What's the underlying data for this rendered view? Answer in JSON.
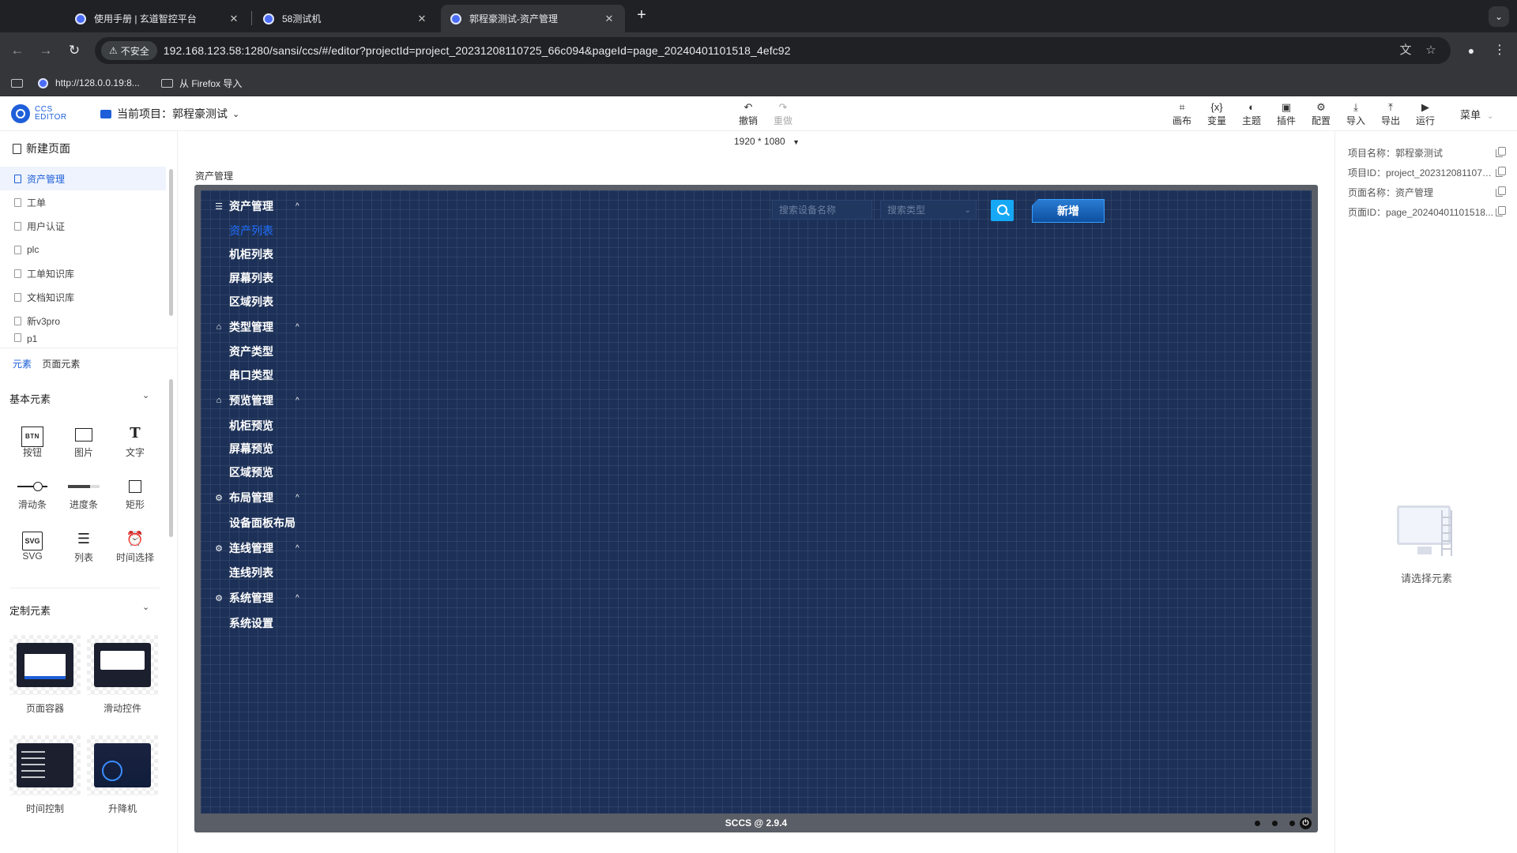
{
  "browser": {
    "tabs": [
      {
        "title": "使用手册 | 玄道智控平台",
        "active": false
      },
      {
        "title": "58测试机",
        "active": false
      },
      {
        "title": "郭程豪测试-资产管理",
        "active": true
      }
    ],
    "security_label": "不安全",
    "url": "192.168.123.58:1280/sansi/ccs/#/editor?projectId=project_20231208110725_66c094&pageId=page_20240401101518_4efc92",
    "bookmarks": [
      "http://128.0.0.19:8...",
      "从 Firefox 导入"
    ]
  },
  "header": {
    "logo_line1": "CCS",
    "logo_line2": "EDITOR",
    "project_label": "当前项目：",
    "project_name": "郭程豪测试",
    "tools": [
      {
        "label": "撤销",
        "icon": "undo-icon",
        "enabled": true
      },
      {
        "label": "重做",
        "icon": "redo-icon",
        "enabled": false
      },
      {
        "label": "画布",
        "icon": "canvas-icon",
        "enabled": true
      },
      {
        "label": "变量",
        "icon": "variable-icon",
        "enabled": true
      },
      {
        "label": "主题",
        "icon": "theme-icon",
        "enabled": true
      },
      {
        "label": "插件",
        "icon": "plugin-icon",
        "enabled": true
      },
      {
        "label": "配置",
        "icon": "config-icon",
        "enabled": true
      },
      {
        "label": "导入",
        "icon": "import-icon",
        "enabled": true
      },
      {
        "label": "导出",
        "icon": "export-icon",
        "enabled": true
      },
      {
        "label": "运行",
        "icon": "run-icon",
        "enabled": true
      }
    ],
    "menu_label": "菜单"
  },
  "left": {
    "new_page_label": "新建页面",
    "pages": [
      "资产管理",
      "工单",
      "用户认证",
      "plc",
      "工单知识库",
      "文档知识库",
      "新v3pro",
      "p1"
    ],
    "active_page": "资产管理",
    "element_tabs": [
      "元素",
      "页面元素"
    ],
    "basic_section": "基本元素",
    "basic_elements": [
      "按钮",
      "图片",
      "文字",
      "滑动条",
      "进度条",
      "矩形",
      "SVG",
      "列表",
      "时间选择"
    ],
    "btn_glyph": "BTN",
    "svg_glyph": "SVG",
    "custom_section": "定制元素",
    "custom_elements": [
      "页面容器",
      "滑动控件",
      "时间控制",
      "升降机"
    ]
  },
  "canvas": {
    "size": "1920 * 1080",
    "page_label": "资产管理",
    "footer": "SCCS @ 2.9.4",
    "preview": {
      "groups": [
        {
          "label": "资产管理",
          "icon": "menu-icon",
          "items": [
            "资产列表",
            "机柜列表",
            "屏幕列表",
            "区域列表"
          ]
        },
        {
          "label": "类型管理",
          "icon": "monitor-icon",
          "items": [
            "资产类型",
            "串口类型"
          ]
        },
        {
          "label": "预览管理",
          "icon": "monitor-icon",
          "items": [
            "机柜预览",
            "屏幕预览",
            "区域预览"
          ]
        },
        {
          "label": "布局管理",
          "icon": "gear-icon",
          "items": [
            "设备面板布局"
          ]
        },
        {
          "label": "连线管理",
          "icon": "gear-icon",
          "items": [
            "连线列表"
          ]
        },
        {
          "label": "系统管理",
          "icon": "gear-icon",
          "items": [
            "系统设置"
          ]
        }
      ],
      "active_item": "资产列表",
      "search_placeholder": "搜索设备名称",
      "type_placeholder": "搜索类型",
      "add_label": "新增"
    }
  },
  "right": {
    "project_name_label": "项目名称：",
    "project_name": "郭程豪测试",
    "project_id_label": "项目ID：",
    "project_id": "project_2023120811072...",
    "page_name_label": "页面名称：",
    "page_name": "资产管理",
    "page_id_label": "页面ID：",
    "page_id": "page_20240401101518...",
    "empty_text": "请选择元素"
  }
}
